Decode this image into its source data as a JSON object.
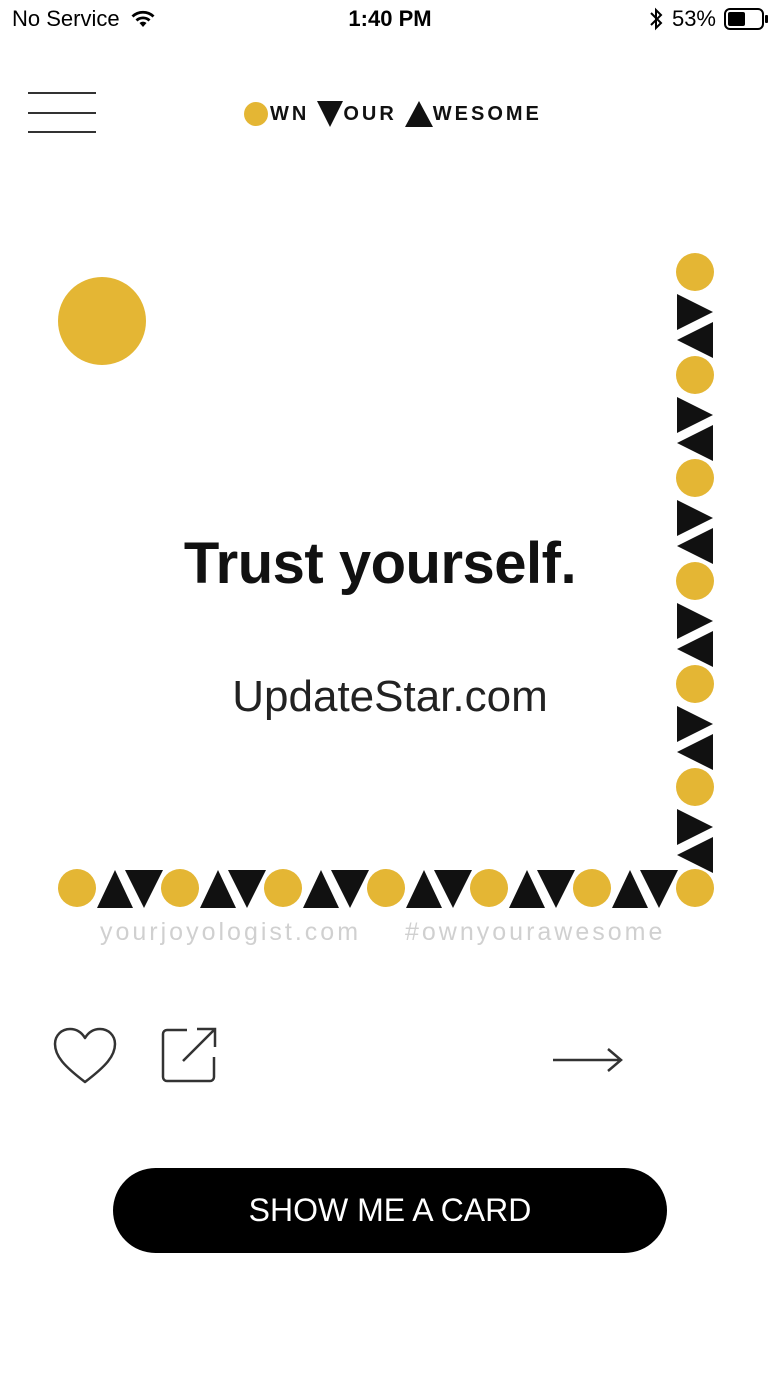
{
  "status_bar": {
    "carrier": "No Service",
    "time": "1:40 PM",
    "battery_percent": "53%",
    "battery_level": 0.53,
    "icons": [
      "wifi-icon",
      "bluetooth-icon",
      "battery-icon"
    ]
  },
  "header": {
    "menu_icon": "hamburger-menu-icon",
    "brand": {
      "part1": "WN",
      "part2": "OUR",
      "part3": "WESOME",
      "accent_color": "#E4B634"
    }
  },
  "card": {
    "quote": "Trust yourself.",
    "watermark": "UpdateStar.com",
    "footer_site": "yourjoyologist.com",
    "footer_tag": "#ownyourawesome",
    "accent_color": "#E4B634",
    "shape_color": "#111111"
  },
  "actions": {
    "like_icon": "heart-icon",
    "share_icon": "share-icon",
    "next_icon": "arrow-right-icon"
  },
  "cta": {
    "label": "SHOW ME A CARD"
  }
}
